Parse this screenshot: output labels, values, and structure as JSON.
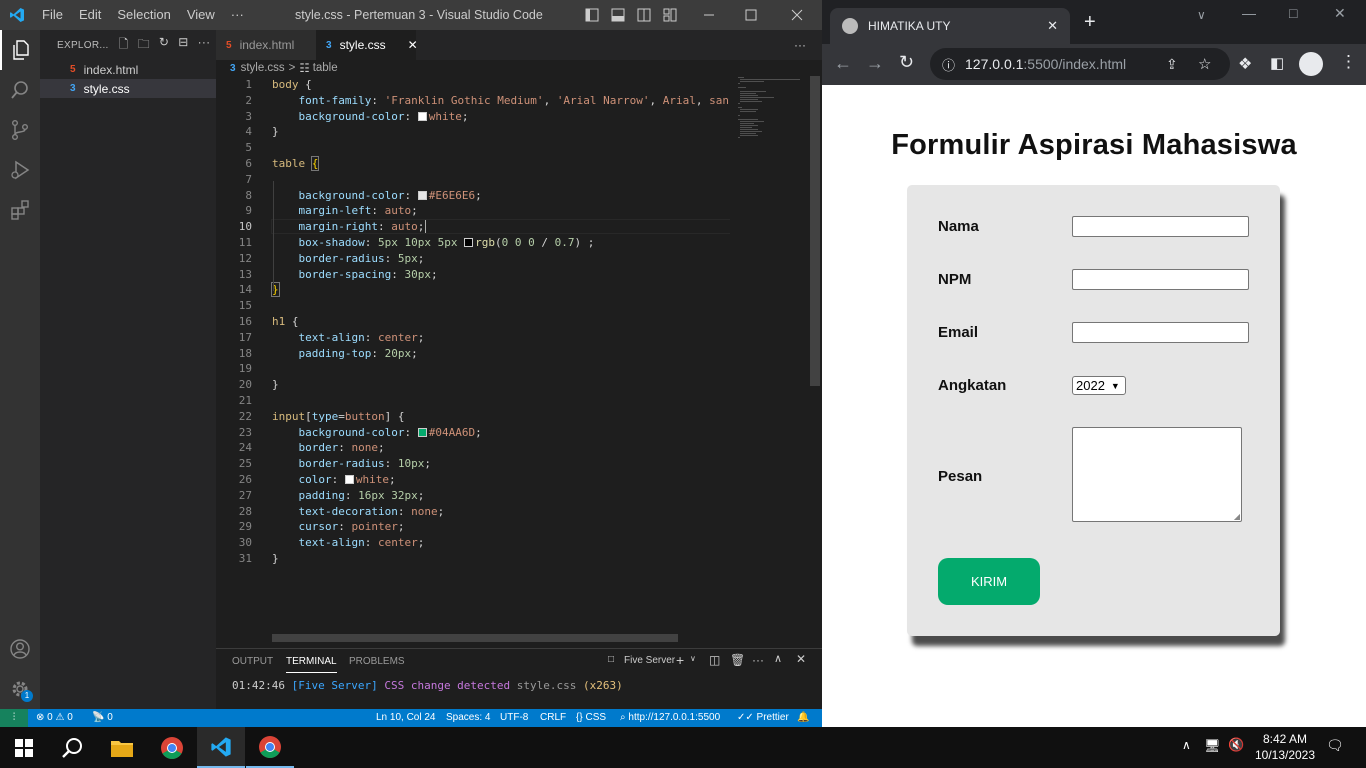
{
  "vscode": {
    "menu": [
      "File",
      "Edit",
      "Selection",
      "View",
      "···"
    ],
    "window_title": "style.css - Pertemuan 3 - Visual Studio Code",
    "explorer_label": "EXPLOR...",
    "files": [
      "index.html",
      "style.css"
    ],
    "tabs": [
      {
        "label": "index.html",
        "active": false
      },
      {
        "label": "style.css",
        "active": true
      }
    ],
    "tabs_more": "···",
    "breadcrumb": {
      "file": "style.css",
      "separator": ">",
      "symbol": "table"
    },
    "code_lines": [
      {
        "n": "1",
        "html": "<span class='k'>body</span> <span class='w'>{</span>"
      },
      {
        "n": "2",
        "html": "    <span class='p'>font-family</span>: <span class='v'>'Franklin Gothic Medium'</span>, <span class='v'>'Arial Narrow'</span>, <span class='v'>Arial</span>, <span class='v'>sans-serif</span>;"
      },
      {
        "n": "3",
        "html": "    <span class='p'>background-color</span>: <span class='sw' style='background:#fff'></span><span class='v'>white</span>;"
      },
      {
        "n": "4",
        "html": "<span class='w'>}</span>"
      },
      {
        "n": "5",
        "html": ""
      },
      {
        "n": "6",
        "html": "<span class='k'>table</span> <span class='b' style='outline:1px solid #777'>{</span>"
      },
      {
        "n": "7",
        "html": ""
      },
      {
        "n": "8",
        "html": "    <span class='p'>background-color</span>: <span class='sw' style='background:#E6E6E6'></span><span class='v'>#E6E6E6</span>;"
      },
      {
        "n": "9",
        "html": "    <span class='p'>margin-left</span>: <span class='v'>auto</span>;"
      },
      {
        "n": "10",
        "html": "    <span class='p'>margin-right</span>: <span class='v'>auto</span>;"
      },
      {
        "n": "11",
        "html": "    <span class='p'>box-shadow</span>: <span class='n'>5px</span> <span class='n'>10px</span> <span class='n'>5px</span> <span class='sw' style='background:#000'></span><span class='f'>rgb</span>(<span class='n'>0</span> <span class='n'>0</span> <span class='n'>0</span> / <span class='n'>0.7</span>) ;"
      },
      {
        "n": "12",
        "html": "    <span class='p'>border-radius</span>: <span class='n'>5px</span>;"
      },
      {
        "n": "13",
        "html": "    <span class='p'>border-spacing</span>: <span class='n'>30px</span>;"
      },
      {
        "n": "14",
        "html": "<span class='b' style='outline:1px solid #777'>}</span>"
      },
      {
        "n": "15",
        "html": ""
      },
      {
        "n": "16",
        "html": "<span class='k'>h1</span> <span class='w'>{</span>"
      },
      {
        "n": "17",
        "html": "    <span class='p'>text-align</span>: <span class='v'>center</span>;"
      },
      {
        "n": "18",
        "html": "    <span class='p'>padding-top</span>: <span class='n'>20px</span>;"
      },
      {
        "n": "19",
        "html": ""
      },
      {
        "n": "20",
        "html": "<span class='w'>}</span>"
      },
      {
        "n": "21",
        "html": ""
      },
      {
        "n": "22",
        "html": "<span class='k'>input</span><span class='w'>[</span><span class='p'>type</span>=<span class='v'>button</span><span class='w'>]</span> <span class='w'>{</span>"
      },
      {
        "n": "23",
        "html": "    <span class='p'>background-color</span>: <span class='sw' style='background:#04AA6D'></span><span class='v'>#04AA6D</span>;"
      },
      {
        "n": "24",
        "html": "    <span class='p'>border</span>: <span class='v'>none</span>;"
      },
      {
        "n": "25",
        "html": "    <span class='p'>border-radius</span>: <span class='n'>10px</span>;"
      },
      {
        "n": "26",
        "html": "    <span class='p'>color</span>: <span class='sw' style='background:#fff'></span><span class='v'>white</span>;"
      },
      {
        "n": "27",
        "html": "    <span class='p'>padding</span>: <span class='n'>16px</span> <span class='n'>32px</span>;"
      },
      {
        "n": "28",
        "html": "    <span class='p'>text-decoration</span>: <span class='v'>none</span>;"
      },
      {
        "n": "29",
        "html": "    <span class='p'>cursor</span>: <span class='v'>pointer</span>;"
      },
      {
        "n": "30",
        "html": "    <span class='p'>text-align</span>: <span class='v'>center</span>;"
      },
      {
        "n": "31",
        "html": "<span class='w'>}</span>"
      }
    ],
    "panel": {
      "tabs": [
        "OUTPUT",
        "TERMINAL",
        "PROBLEMS"
      ],
      "active_tab": "TERMINAL",
      "terminal_name": "Five Server",
      "terminal_time": "01:42:46",
      "terminal_tag": "[Five Server]",
      "terminal_msg1": "CSS",
      "terminal_msg2": "change detected",
      "terminal_file": "style.css",
      "terminal_count": "(x263)"
    },
    "status": {
      "errors": "0",
      "warnings": "0",
      "ports": "0",
      "position": "Ln 10, Col 24",
      "spaces": "Spaces: 4",
      "encoding": "UTF-8",
      "eol": "CRLF",
      "language": "CSS",
      "server": "http://127.0.0.1:5500",
      "formatter": "Prettier"
    },
    "accounts_badge": "1"
  },
  "chrome": {
    "tab_title": "HIMATIKA UTY",
    "url_host": "127.0.0.1",
    "url_rest": ":5500/index.html"
  },
  "form": {
    "title": "Formulir Aspirasi Mahasiswa",
    "labels": [
      "Nama",
      "NPM",
      "Email",
      "Angkatan",
      "Pesan"
    ],
    "angkatan_value": "2022",
    "submit_label": "KIRIM",
    "bg_color": "#E6E6E6",
    "button_color": "#04AA6D"
  },
  "taskbar": {
    "time": "8:42 AM",
    "date": "10/13/2023"
  }
}
